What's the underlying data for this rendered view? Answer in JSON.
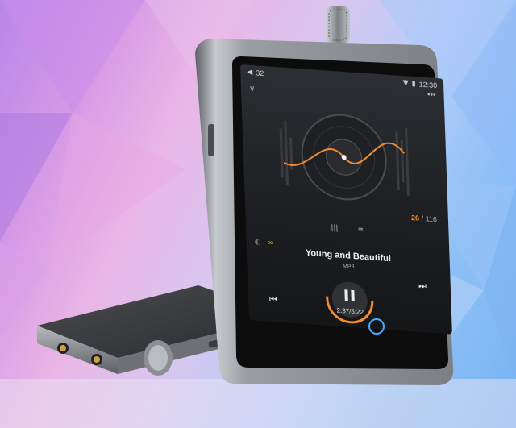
{
  "screen": {
    "status": {
      "volume": "32",
      "time": "12:30"
    },
    "track_counter": {
      "current": "26",
      "total": "116"
    },
    "song": {
      "title": "Young and Beautiful",
      "format": "MP3"
    },
    "playback_time": "2:37/5:22"
  },
  "icons": {
    "volume": "speaker-icon",
    "wifi": "wifi-icon",
    "battery": "battery-icon",
    "more": "more-dots-icon",
    "collapse": "chevron-down-icon",
    "playlist": "playlist-icon",
    "menu": "menu-lines-icon",
    "prev": "previous-track-icon",
    "next": "next-track-icon",
    "pause": "pause-icon",
    "home": "home-button-icon"
  },
  "colors": {
    "accent": "#f28a2e",
    "device_metal": "#8c8f94",
    "screen_bg": "#1d1f22"
  }
}
